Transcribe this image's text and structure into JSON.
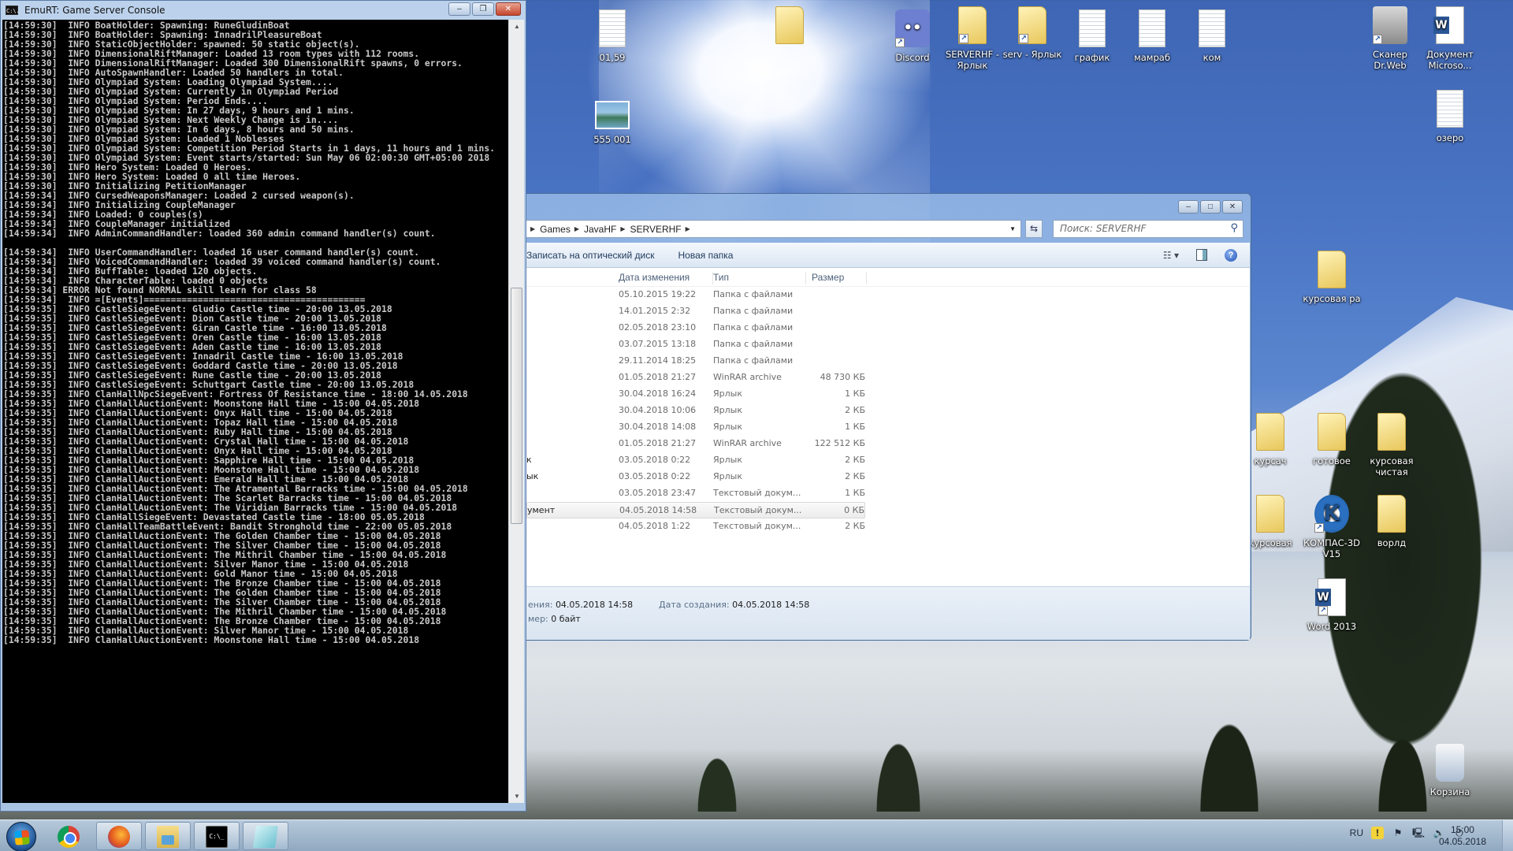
{
  "console": {
    "title": "EmuRT: Game Server Console",
    "icon": "cmd-icon",
    "icon_text": "C:\\.",
    "buttons": {
      "minimize": "–",
      "maximize": "❐",
      "close": "✕"
    },
    "lines": [
      "[14:59:30]  INFO BoatHolder: Spawning: RuneGludinBoat",
      "[14:59:30]  INFO BoatHolder: Spawning: InnadrilPleasureBoat",
      "[14:59:30]  INFO StaticObjectHolder: spawned: 50 static object(s).",
      "[14:59:30]  INFO DimensionalRiftManager: Loaded 13 room types with 112 rooms.",
      "[14:59:30]  INFO DimensionalRiftManager: Loaded 300 DimensionalRift spawns, 0 errors.",
      "[14:59:30]  INFO AutoSpawnHandler: Loaded 50 handlers in total.",
      "[14:59:30]  INFO Olympiad System: Loading Olympiad System....",
      "[14:59:30]  INFO Olympiad System: Currently in Olympiad Period",
      "[14:59:30]  INFO Olympiad System: Period Ends....",
      "[14:59:30]  INFO Olympiad System: In 27 days, 9 hours and 1 mins.",
      "[14:59:30]  INFO Olympiad System: Next Weekly Change is in....",
      "[14:59:30]  INFO Olympiad System: In 6 days, 8 hours and 50 mins.",
      "[14:59:30]  INFO Olympiad System: Loaded 1 Noblesses",
      "[14:59:30]  INFO Olympiad System: Competition Period Starts in 1 days, 11 hours and 1 mins.",
      "[14:59:30]  INFO Olympiad System: Event starts/started: Sun May 06 02:00:30 GMT+05:00 2018",
      "[14:59:30]  INFO Hero System: Loaded 0 Heroes.",
      "[14:59:30]  INFO Hero System: Loaded 0 all time Heroes.",
      "[14:59:30]  INFO Initializing PetitionManager",
      "[14:59:34]  INFO CursedWeaponsManager: Loaded 2 cursed weapon(s).",
      "[14:59:34]  INFO Initializing CoupleManager",
      "[14:59:34]  INFO Loaded: 0 couples(s)",
      "[14:59:34]  INFO CoupleManager initialized",
      "[14:59:34]  INFO AdminCommandHandler: loaded 360 admin command handler(s) count.",
      "",
      "[14:59:34]  INFO UserCommandHandler: loaded 16 user command handler(s) count.",
      "[14:59:34]  INFO VoicedCommandHandler: loaded 39 voiced command handler(s) count.",
      "[14:59:34]  INFO BuffTable: loaded 120 objects.",
      "[14:59:34]  INFO CharacterTable: loaded 0 objects",
      "[14:59:34] ERROR Not found NORMAL skill learn for class 58",
      "[14:59:34]  INFO =[Events]=========================================",
      "[14:59:35]  INFO CastleSiegeEvent: Gludio Castle time - 20:00 13.05.2018",
      "[14:59:35]  INFO CastleSiegeEvent: Dion Castle time - 20:00 13.05.2018",
      "[14:59:35]  INFO CastleSiegeEvent: Giran Castle time - 16:00 13.05.2018",
      "[14:59:35]  INFO CastleSiegeEvent: Oren Castle time - 16:00 13.05.2018",
      "[14:59:35]  INFO CastleSiegeEvent: Aden Castle time - 16:00 13.05.2018",
      "[14:59:35]  INFO CastleSiegeEvent: Innadril Castle time - 16:00 13.05.2018",
      "[14:59:35]  INFO CastleSiegeEvent: Goddard Castle time - 20:00 13.05.2018",
      "[14:59:35]  INFO CastleSiegeEvent: Rune Castle time - 20:00 13.05.2018",
      "[14:59:35]  INFO CastleSiegeEvent: Schuttgart Castle time - 20:00 13.05.2018",
      "[14:59:35]  INFO ClanHallNpcSiegeEvent: Fortress Of Resistance time - 18:00 14.05.2018",
      "[14:59:35]  INFO ClanHallAuctionEvent: Moonstone Hall time - 15:00 04.05.2018",
      "[14:59:35]  INFO ClanHallAuctionEvent: Onyx Hall time - 15:00 04.05.2018",
      "[14:59:35]  INFO ClanHallAuctionEvent: Topaz Hall time - 15:00 04.05.2018",
      "[14:59:35]  INFO ClanHallAuctionEvent: Ruby Hall time - 15:00 04.05.2018",
      "[14:59:35]  INFO ClanHallAuctionEvent: Crystal Hall time - 15:00 04.05.2018",
      "[14:59:35]  INFO ClanHallAuctionEvent: Onyx Hall time - 15:00 04.05.2018",
      "[14:59:35]  INFO ClanHallAuctionEvent: Sapphire Hall time - 15:00 04.05.2018",
      "[14:59:35]  INFO ClanHallAuctionEvent: Moonstone Hall time - 15:00 04.05.2018",
      "[14:59:35]  INFO ClanHallAuctionEvent: Emerald Hall time - 15:00 04.05.2018",
      "[14:59:35]  INFO ClanHallAuctionEvent: The Atramental Barracks time - 15:00 04.05.2018",
      "[14:59:35]  INFO ClanHallAuctionEvent: The Scarlet Barracks time - 15:00 04.05.2018",
      "[14:59:35]  INFO ClanHallAuctionEvent: The Viridian Barracks time - 15:00 04.05.2018",
      "[14:59:35]  INFO ClanHallSiegeEvent: Devastated Castle time - 18:00 05.05.2018",
      "[14:59:35]  INFO ClanHallTeamBattleEvent: Bandit Stronghold time - 22:00 05.05.2018",
      "[14:59:35]  INFO ClanHallAuctionEvent: The Golden Chamber time - 15:00 04.05.2018",
      "[14:59:35]  INFO ClanHallAuctionEvent: The Silver Chamber time - 15:00 04.05.2018",
      "[14:59:35]  INFO ClanHallAuctionEvent: The Mithril Chamber time - 15:00 04.05.2018",
      "[14:59:35]  INFO ClanHallAuctionEvent: Silver Manor time - 15:00 04.05.2018",
      "[14:59:35]  INFO ClanHallAuctionEvent: Gold Manor time - 15:00 04.05.2018",
      "[14:59:35]  INFO ClanHallAuctionEvent: The Bronze Chamber time - 15:00 04.05.2018",
      "[14:59:35]  INFO ClanHallAuctionEvent: The Golden Chamber time - 15:00 04.05.2018",
      "[14:59:35]  INFO ClanHallAuctionEvent: The Silver Chamber time - 15:00 04.05.2018",
      "[14:59:35]  INFO ClanHallAuctionEvent: The Mithril Chamber time - 15:00 04.05.2018",
      "[14:59:35]  INFO ClanHallAuctionEvent: The Bronze Chamber time - 15:00 04.05.2018",
      "[14:59:35]  INFO ClanHallAuctionEvent: Silver Manor time - 15:00 04.05.2018",
      "[14:59:35]  INFO ClanHallAuctionEvent: Moonstone Hall time - 15:00 04.05.2018"
    ]
  },
  "explorer": {
    "buttons": {
      "minimize": "–",
      "maximize": "□",
      "close": "✕"
    },
    "breadcrumb": [
      "Games",
      "JavaHF",
      "SERVERHF"
    ],
    "search_placeholder": "Поиск: SERVERHF",
    "toolbar": {
      "burn": "Записать на оптический диск",
      "new_folder": "Новая папка"
    },
    "columns": {
      "date": "Дата изменения",
      "type": "Тип",
      "size": "Размер"
    },
    "rows": [
      {
        "name": "",
        "date": "05.10.2015 19:22",
        "type": "Папка с файлами",
        "size": ""
      },
      {
        "name": "",
        "date": "14.01.2015 2:32",
        "type": "Папка с файлами",
        "size": ""
      },
      {
        "name": "",
        "date": "02.05.2018 23:10",
        "type": "Папка с файлами",
        "size": ""
      },
      {
        "name": "",
        "date": "03.07.2015 13:18",
        "type": "Папка с файлами",
        "size": ""
      },
      {
        "name": "",
        "date": "29.11.2014 18:25",
        "type": "Папка с файлами",
        "size": ""
      },
      {
        "name": "",
        "date": "01.05.2018 21:27",
        "type": "WinRAR archive",
        "size": "48 730 КБ"
      },
      {
        "name": "",
        "date": "30.04.2018 16:24",
        "type": "Ярлык",
        "size": "1 КБ"
      },
      {
        "name": "",
        "date": "30.04.2018 10:06",
        "type": "Ярлык",
        "size": "2 КБ"
      },
      {
        "name": "",
        "date": "30.04.2018 14:08",
        "type": "Ярлык",
        "size": "1 КБ"
      },
      {
        "name": "",
        "date": "01.05.2018 21:27",
        "type": "WinRAR archive",
        "size": "122 512 КБ"
      },
      {
        "name": "к",
        "date": "03.05.2018 0:22",
        "type": "Ярлык",
        "size": "2 КБ"
      },
      {
        "name": "ык",
        "date": "03.05.2018 0:22",
        "type": "Ярлык",
        "size": "2 КБ"
      },
      {
        "name": "",
        "date": "03.05.2018 23:47",
        "type": "Текстовый докум...",
        "size": "1 КБ"
      },
      {
        "name": "умент",
        "date": "04.05.2018 14:58",
        "type": "Текстовый докум...",
        "size": "0 КБ",
        "selected": true
      },
      {
        "name": "",
        "date": "04.05.2018 1:22",
        "type": "Текстовый докум...",
        "size": "2 КБ"
      }
    ],
    "details": {
      "modified_label": "ения:",
      "modified_value": "04.05.2018 14:58",
      "created_label": "Дата создания:",
      "created_value": "04.05.2018 14:58",
      "size_label": "мер:",
      "size_value": "0 байт"
    }
  },
  "desktop_icons": [
    {
      "label": "01,59",
      "kind": "doc"
    },
    {
      "label": "555 001",
      "kind": "img"
    },
    {
      "label": "",
      "kind": "folder"
    },
    {
      "label": "Discord",
      "kind": "discord",
      "shortcut": true
    },
    {
      "label": "SERVERHF - Ярлык",
      "kind": "folder",
      "shortcut": true
    },
    {
      "label": "serv - Ярлык",
      "kind": "folder",
      "shortcut": true
    },
    {
      "label": "график",
      "kind": "doc"
    },
    {
      "label": "мамраб",
      "kind": "doc"
    },
    {
      "label": "ком",
      "kind": "doc"
    },
    {
      "label": "Сканер Dr.Web",
      "kind": "drweb",
      "shortcut": true
    },
    {
      "label": "Документ Microso...",
      "kind": "word"
    },
    {
      "label": "озеро",
      "kind": "doc"
    },
    {
      "label": "курсовая ра",
      "kind": "folder"
    },
    {
      "label": "курсач",
      "kind": "folder"
    },
    {
      "label": "готовое",
      "kind": "folder"
    },
    {
      "label": "курсовая чистая",
      "kind": "folder"
    },
    {
      "label": "курсовая",
      "kind": "folder"
    },
    {
      "label": "КОМПАС-3D V15",
      "kind": "kompas",
      "shortcut": true
    },
    {
      "label": "ворлд",
      "kind": "folder"
    },
    {
      "label": "Word 2013",
      "kind": "word",
      "shortcut": true
    },
    {
      "label": "Корзина",
      "kind": "recycle"
    }
  ],
  "taskbar": {
    "apps": [
      {
        "name": "chrome",
        "state": "pinned"
      },
      {
        "name": "firefox",
        "state": "running"
      },
      {
        "name": "explorer",
        "state": "running"
      },
      {
        "name": "cmd",
        "state": "running",
        "text": "C:\\_"
      },
      {
        "name": "notepad",
        "state": "running"
      }
    ],
    "language": "RU",
    "time": "15:00",
    "date": "04.05.2018"
  }
}
